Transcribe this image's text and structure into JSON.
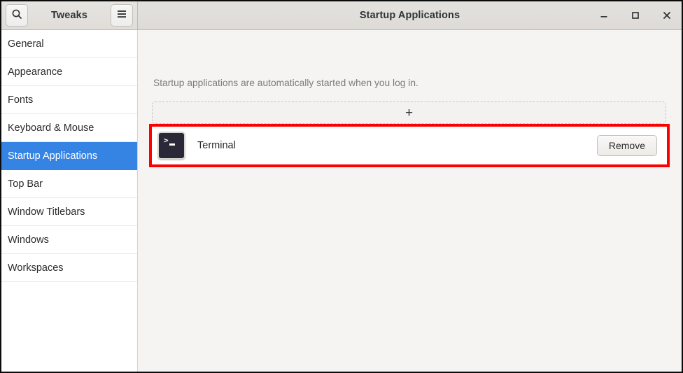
{
  "window": {
    "app_title": "Tweaks",
    "page_title": "Startup Applications",
    "search_icon": "search-icon",
    "menu_icon": "hamburger-menu-icon",
    "controls": {
      "minimize": "–",
      "maximize": "□",
      "close": "✕"
    },
    "accent_color": "#3584e4",
    "highlight_color": "#fd0000"
  },
  "sidebar": {
    "items": [
      {
        "label": "General",
        "selected": false
      },
      {
        "label": "Appearance",
        "selected": false
      },
      {
        "label": "Fonts",
        "selected": false
      },
      {
        "label": "Keyboard & Mouse",
        "selected": false
      },
      {
        "label": "Startup Applications",
        "selected": true
      },
      {
        "label": "Top Bar",
        "selected": false
      },
      {
        "label": "Window Titlebars",
        "selected": false
      },
      {
        "label": "Windows",
        "selected": false
      },
      {
        "label": "Workspaces",
        "selected": false
      }
    ]
  },
  "main": {
    "description": "Startup applications are automatically started when you log in.",
    "add_button_label": "+",
    "apps": [
      {
        "name": "Terminal",
        "icon": "terminal-icon",
        "icon_prompt": ">",
        "remove_label": "Remove"
      }
    ]
  }
}
